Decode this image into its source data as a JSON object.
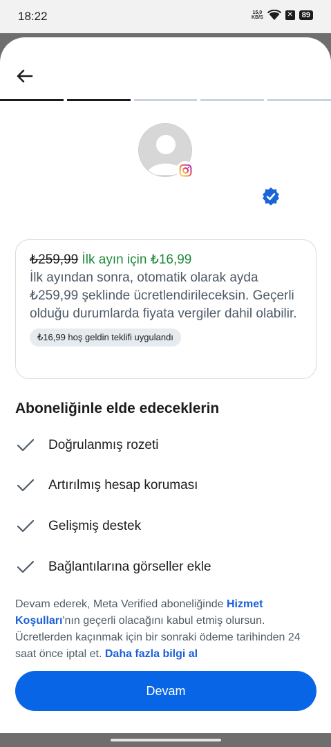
{
  "status": {
    "time": "18:22",
    "net_speed_value": "15,0",
    "net_speed_unit": "KB/S",
    "battery": "89",
    "icons": [
      "wifi-icon",
      "xbox-icon",
      "battery-icon"
    ]
  },
  "header": {
    "back_icon": "arrow-left-icon"
  },
  "progress": {
    "total_steps": 5,
    "completed_steps": 2
  },
  "profile": {
    "avatar_icon": "avatar-placeholder-icon",
    "badge_icon": "instagram-icon",
    "verified_icon": "verified-badge-icon"
  },
  "pricing": {
    "old_price": "₺259,99",
    "first_month": "İlk ayın için ₺16,99",
    "description": "İlk ayından sonra, otomatik olarak ayda ₺259,99 şeklinde ücretlendirileceksin. Geçerli olduğu durumlarda fiyata vergiler dahil olabilir.",
    "offer_chip": "₺16,99 hoş geldin teklifi uygulandı"
  },
  "benefits": {
    "title": "Aboneliğinle elde edeceklerin",
    "items": [
      "Doğrulanmış rozeti",
      "Artırılmış hesap koruması",
      "Gelişmiş destek",
      "Bağlantılarına görseller ekle"
    ]
  },
  "legal": {
    "part1": "Devam ederek, Meta Verified aboneliğinde ",
    "terms_link": "Hizmet Koşulları",
    "part2": "'nın geçerli olacağını kabul etmiş olursun. Ücretlerden kaçınmak için bir sonraki ödeme tarihinden 24 saat önce iptal et. ",
    "learn_more_link": "Daha fazla bilgi al"
  },
  "actions": {
    "continue_label": "Devam"
  },
  "colors": {
    "primary": "#0866e6",
    "success": "#1e8a3a",
    "link": "#1a5fd6"
  }
}
